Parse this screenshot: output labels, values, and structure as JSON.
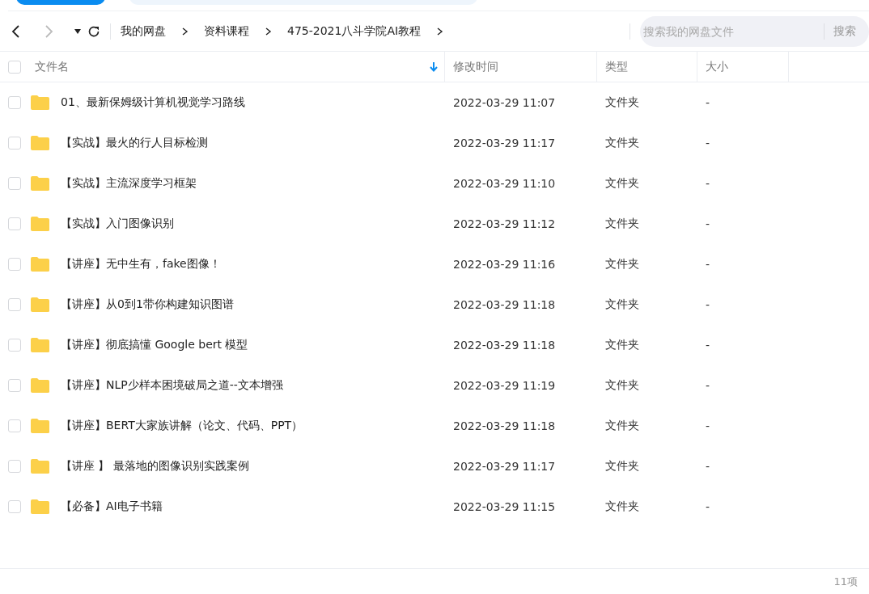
{
  "nav": {
    "back_disabled": false,
    "forward_disabled": true
  },
  "breadcrumb": [
    "我的网盘",
    "资料课程",
    "475-2021八斗学院AI教程"
  ],
  "search": {
    "placeholder": "搜索我的网盘文件",
    "button": "搜索"
  },
  "table": {
    "all_checked": false,
    "columns": [
      {
        "label": "文件名",
        "sorted": true
      },
      {
        "label": "修改时间",
        "sorted": false
      },
      {
        "label": "类型",
        "sorted": false
      },
      {
        "label": "大小",
        "sorted": false
      }
    ],
    "rows": [
      {
        "name": "01、最新保姆级计算机视觉学习路线",
        "modified": "2022-03-29 11:07",
        "type": "文件夹",
        "size": "-",
        "checked": false
      },
      {
        "name": "【实战】最火的行人目标检测",
        "modified": "2022-03-29 11:17",
        "type": "文件夹",
        "size": "-",
        "checked": false
      },
      {
        "name": "【实战】主流深度学习框架",
        "modified": "2022-03-29 11:10",
        "type": "文件夹",
        "size": "-",
        "checked": false
      },
      {
        "name": "【实战】入门图像识别",
        "modified": "2022-03-29 11:12",
        "type": "文件夹",
        "size": "-",
        "checked": false
      },
      {
        "name": "【讲座】无中生有，fake图像！",
        "modified": "2022-03-29 11:16",
        "type": "文件夹",
        "size": "-",
        "checked": false
      },
      {
        "name": "【讲座】从0到1带你构建知识图谱",
        "modified": "2022-03-29 11:18",
        "type": "文件夹",
        "size": "-",
        "checked": false
      },
      {
        "name": "【讲座】彻底搞懂 Google bert 模型",
        "modified": "2022-03-29 11:18",
        "type": "文件夹",
        "size": "-",
        "checked": false
      },
      {
        "name": "【讲座】NLP少样本困境破局之道--文本增强",
        "modified": "2022-03-29 11:19",
        "type": "文件夹",
        "size": "-",
        "checked": false
      },
      {
        "name": "【讲座】BERT大家族讲解（论文、代码、PPT）",
        "modified": "2022-03-29 11:18",
        "type": "文件夹",
        "size": "-",
        "checked": false
      },
      {
        "name": "【讲座 】 最落地的图像识别实践案例",
        "modified": "2022-03-29 11:17",
        "type": "文件夹",
        "size": "-",
        "checked": false
      },
      {
        "name": "【必备】AI电子书籍",
        "modified": "2022-03-29 11:15",
        "type": "文件夹",
        "size": "-",
        "checked": false
      }
    ]
  },
  "status_bar": {
    "count": "11项"
  }
}
